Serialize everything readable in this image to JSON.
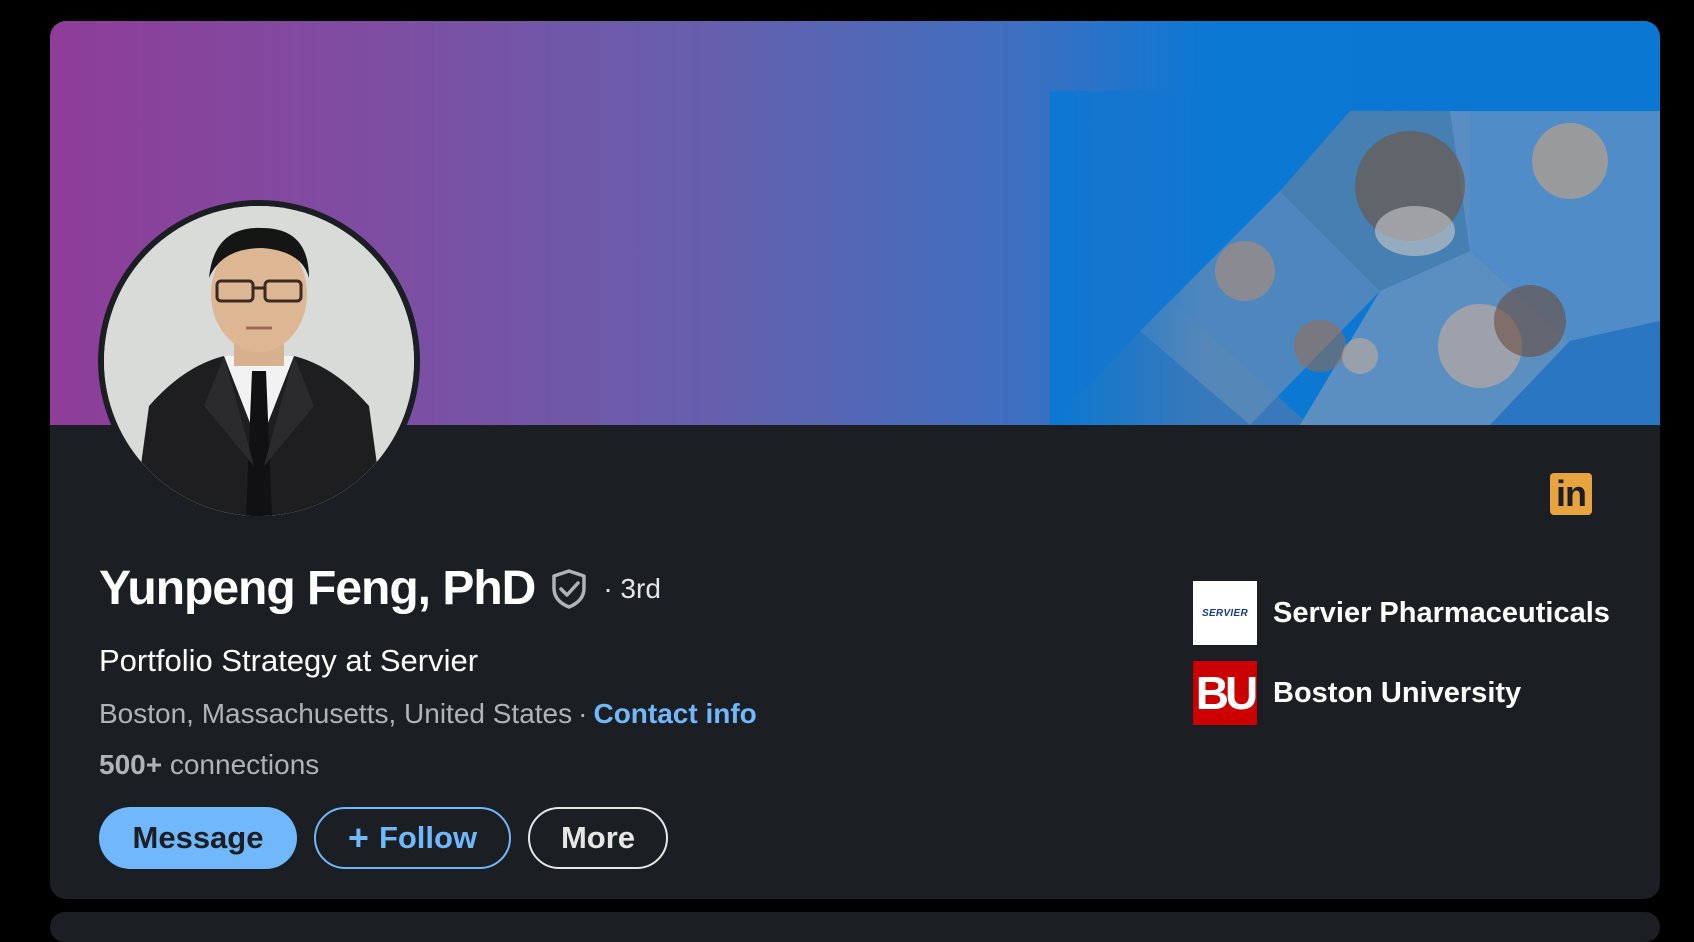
{
  "profile": {
    "name": "Yunpeng Feng, PhD",
    "degree": "· 3rd",
    "headline": "Portfolio Strategy at Servier",
    "location": "Boston, Massachusetts, United States",
    "separator": "·",
    "contact_info": "Contact info",
    "connections_count": "500+",
    "connections_label": "connections"
  },
  "brand": {
    "logo_text": "in",
    "logo_color": "#e7a33e"
  },
  "actions": {
    "message_label": "Message",
    "follow_plus": "+",
    "follow_label": "Follow",
    "more_label": "More"
  },
  "organizations": [
    {
      "name": "Servier Pharmaceuticals",
      "logo_text": "SERVIER"
    },
    {
      "name": "Boston University",
      "logo_text": "BU"
    }
  ],
  "colors": {
    "background": "#000000",
    "card": "#1b1f23",
    "accent": "#71b7fb",
    "banner_start": "#8e3d98",
    "banner_end": "#0a78d2"
  }
}
